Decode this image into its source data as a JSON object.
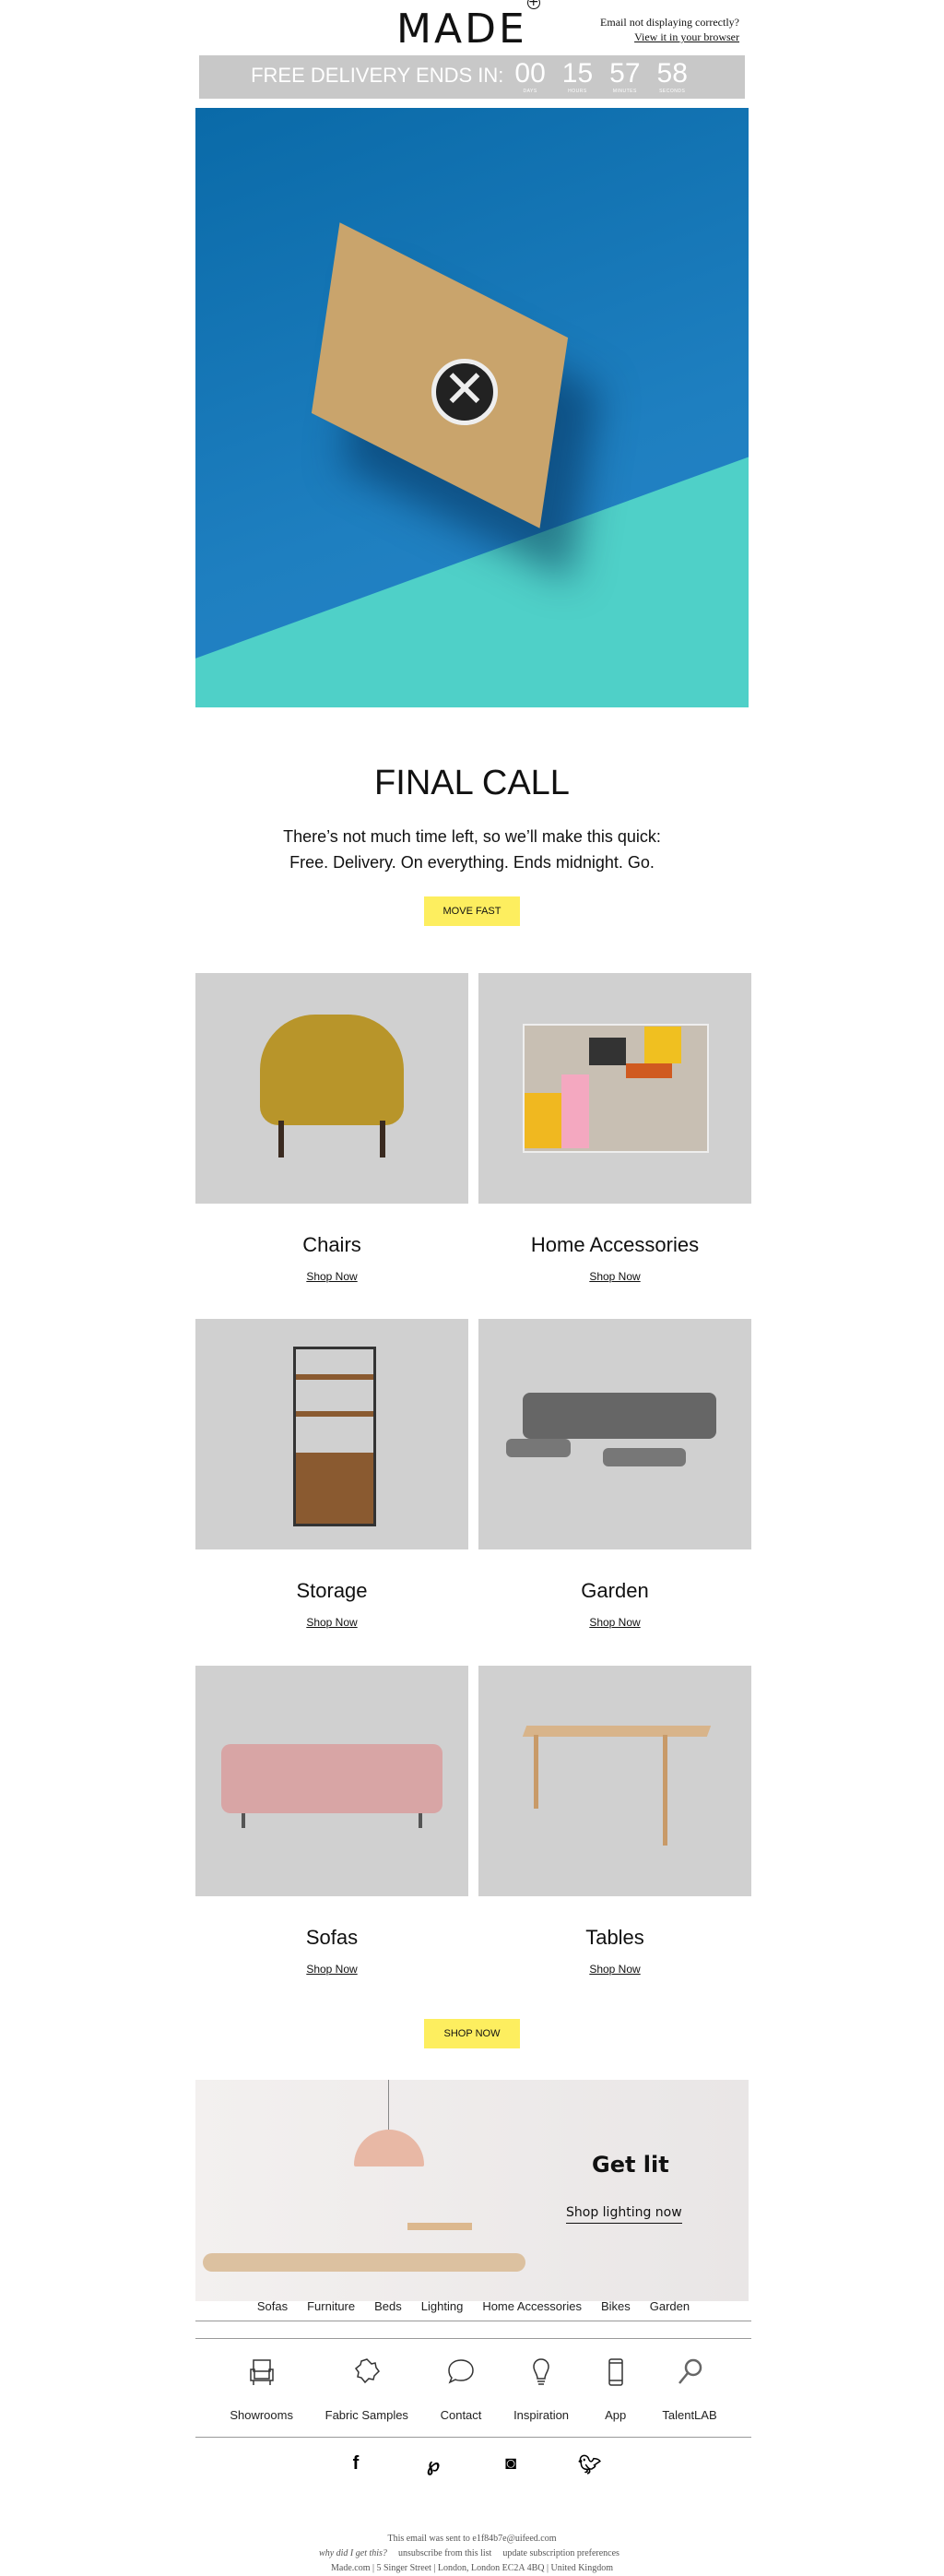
{
  "header": {
    "logo": "MADE",
    "email_note": "Email not displaying correctly?",
    "view_browser": "View it in your browser"
  },
  "countdown": {
    "label": "FREE DELIVERY ENDS IN:",
    "units": [
      {
        "value": "00",
        "unit": "DAYS"
      },
      {
        "value": "15",
        "unit": "HOURS"
      },
      {
        "value": "57",
        "unit": "MINUTES"
      },
      {
        "value": "58",
        "unit": "SECONDS"
      }
    ]
  },
  "hero": {
    "title": "FINAL CALL",
    "line1": "There’s not much time left, so we’ll make this quick:",
    "line2": "Free. Delivery. On everything. Ends midnight. Go.",
    "cta": "MOVE FAST"
  },
  "colors": {
    "cta": "#fdee5f",
    "countdown_bg": "#c8c8c8",
    "hero_blue": "#1e7fc0",
    "card_bg": "#d0d0d0"
  },
  "categories": [
    {
      "name": "Chairs",
      "link": "Shop Now"
    },
    {
      "name": "Home Accessories",
      "link": "Shop Now"
    },
    {
      "name": "Storage",
      "link": "Shop Now"
    },
    {
      "name": "Garden",
      "link": "Shop Now"
    },
    {
      "name": "Sofas",
      "link": "Shop Now"
    },
    {
      "name": "Tables",
      "link": "Shop Now"
    }
  ],
  "shop_now_cta": "SHOP NOW",
  "banner": {
    "title": "Get lit",
    "link": "Shop lighting now"
  },
  "footer_nav": [
    "Sofas",
    "Furniture",
    "Beds",
    "Lighting",
    "Home Accessories",
    "Bikes",
    "Garden"
  ],
  "services": [
    {
      "label": "Showrooms",
      "icon": "armchair-icon"
    },
    {
      "label": "Fabric Samples",
      "icon": "fabric-swatch-icon"
    },
    {
      "label": "Contact",
      "icon": "speech-bubble-icon"
    },
    {
      "label": "Inspiration",
      "icon": "lightbulb-icon"
    },
    {
      "label": "App",
      "icon": "phone-icon"
    },
    {
      "label": "TalentLAB",
      "icon": "magnifier-icon"
    }
  ],
  "social": [
    "facebook-icon",
    "pinterest-icon",
    "instagram-icon",
    "twitter-icon"
  ],
  "legal": {
    "sent_to": "This email was sent to e1f84b7e@uifeed.com",
    "why": "why did I get this?",
    "unsubscribe": "unsubscribe from this list",
    "update": "update subscription preferences",
    "address": "Made.com | 5 Singer Street | London, London EC2A 4BQ | United Kingdom"
  }
}
